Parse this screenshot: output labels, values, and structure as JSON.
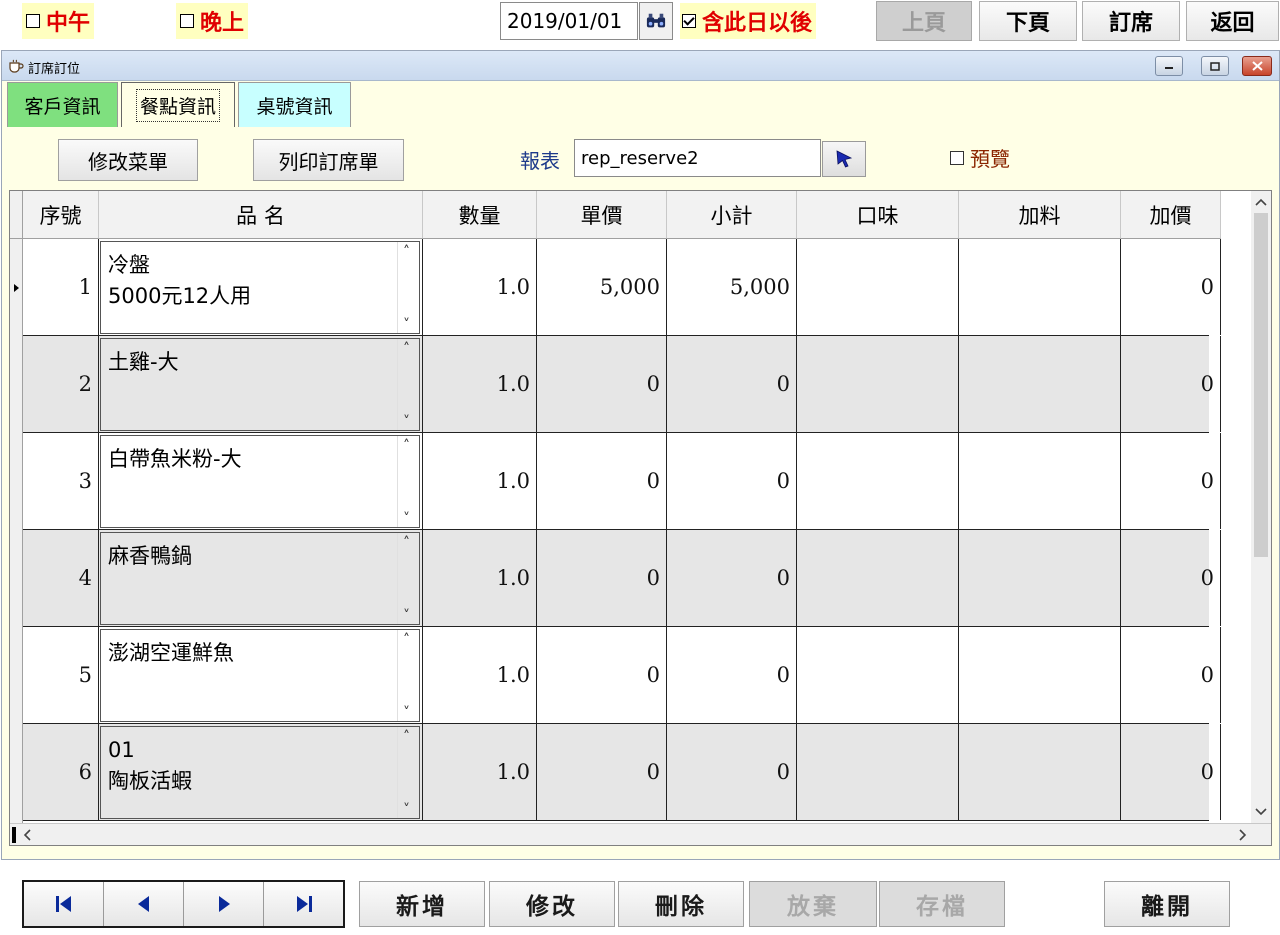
{
  "topbar": {
    "noon_label": "中午",
    "evening_label": "晚上",
    "date_value": "2019/01/01",
    "include_after_label": "含此日以後",
    "prev_page_label": "上頁",
    "next_page_label": "下頁",
    "reserve_label": "訂席",
    "back_label": "返回"
  },
  "window": {
    "title": "訂席訂位",
    "tabs": [
      {
        "label": "客戶資訊"
      },
      {
        "label": "餐點資訊"
      },
      {
        "label": "桌號資訊"
      }
    ],
    "edit_menu_label": "修改菜單",
    "print_order_label": "列印訂席單",
    "report_label": "報表",
    "report_value": "rep_reserve2",
    "preview_label": "預覽"
  },
  "grid": {
    "columns": [
      "序號",
      "品 名",
      "數量",
      "單價",
      "小計",
      "口味",
      "加料",
      "加價"
    ],
    "rows": [
      {
        "seq": "1",
        "name": "冷盤\n5000元12人用",
        "qty": "1.0",
        "price": "5,000",
        "subtotal": "5,000",
        "flavor": "",
        "addon": "",
        "extra": "0"
      },
      {
        "seq": "2",
        "name": "土雞-大",
        "qty": "1.0",
        "price": "0",
        "subtotal": "0",
        "flavor": "",
        "addon": "",
        "extra": "0"
      },
      {
        "seq": "3",
        "name": "白帶魚米粉-大",
        "qty": "1.0",
        "price": "0",
        "subtotal": "0",
        "flavor": "",
        "addon": "",
        "extra": "0"
      },
      {
        "seq": "4",
        "name": "麻香鴨鍋",
        "qty": "1.0",
        "price": "0",
        "subtotal": "0",
        "flavor": "",
        "addon": "",
        "extra": "0"
      },
      {
        "seq": "5",
        "name": "澎湖空運鮮魚",
        "qty": "1.0",
        "price": "0",
        "subtotal": "0",
        "flavor": "",
        "addon": "",
        "extra": "0"
      },
      {
        "seq": "6",
        "name": "01\n陶板活蝦",
        "qty": "1.0",
        "price": "0",
        "subtotal": "0",
        "flavor": "",
        "addon": "",
        "extra": "0"
      }
    ]
  },
  "bottombar": {
    "add_label": "新增",
    "edit_label": "修改",
    "delete_label": "刪除",
    "discard_label": "放棄",
    "save_label": "存檔",
    "exit_label": "離開"
  },
  "colors": {
    "highlight_bg": "#ffffc0",
    "alert_text": "#e00000",
    "form_bg": "#ffffe6",
    "tab_customer": "#7fe07f",
    "tab_meal": "#ffffe6",
    "tab_table": "#c8ffff",
    "nav_arrow": "#0a2a9a"
  }
}
